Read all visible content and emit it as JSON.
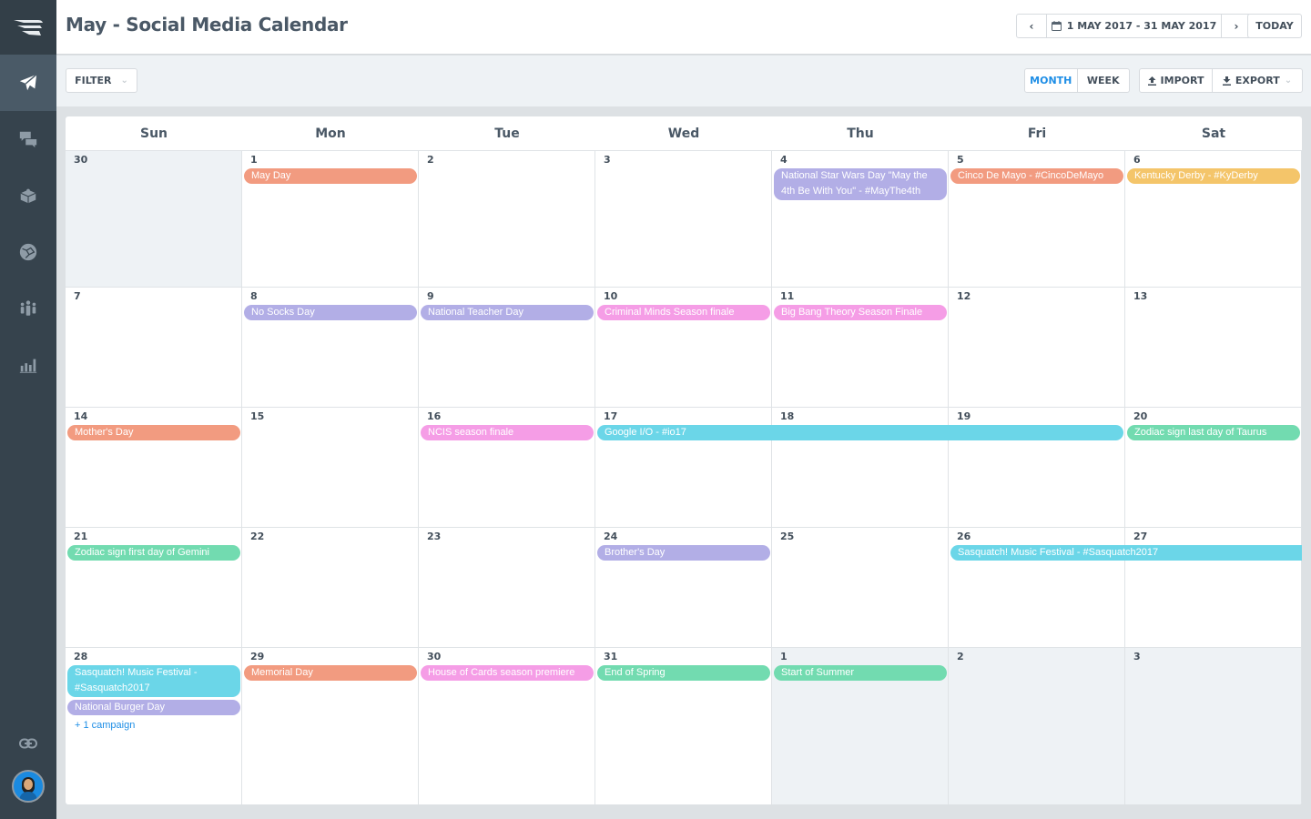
{
  "app": {
    "title": "May - Social Media Calendar"
  },
  "colors": {
    "orange": "#f29b80",
    "purple": "#b2aee6",
    "pink": "#f59de6",
    "cyan": "#6bd6e8",
    "green": "#72dbb0",
    "yellow": "#f4c56a",
    "accent": "#1e8ee6"
  },
  "sidebar": {
    "logo_icon": "wing-logo-icon",
    "items": [
      {
        "name": "publish",
        "icon": "paper-plane-icon",
        "active": true
      },
      {
        "name": "conversations",
        "icon": "chat-bubbles-icon",
        "active": false
      },
      {
        "name": "library",
        "icon": "box-icon",
        "active": false
      },
      {
        "name": "network",
        "icon": "globe-icon",
        "active": false
      },
      {
        "name": "team",
        "icon": "people-icon",
        "active": false
      },
      {
        "name": "reports",
        "icon": "bar-chart-icon",
        "active": false
      }
    ],
    "bottom": [
      {
        "name": "links",
        "icon": "link-icon"
      },
      {
        "name": "profile",
        "icon": "avatar-icon"
      }
    ]
  },
  "header": {
    "date_range": "1 MAY 2017 - 31 MAY 2017",
    "prev_label": "‹",
    "next_label": "›",
    "today_label": "TODAY"
  },
  "toolbar": {
    "filter_label": "FILTER",
    "month_label": "MONTH",
    "week_label": "WEEK",
    "active_view": "MONTH",
    "import_label": "IMPORT",
    "export_label": "EXPORT"
  },
  "calendar": {
    "weekdays": [
      "Sun",
      "Mon",
      "Tue",
      "Wed",
      "Thu",
      "Fri",
      "Sat"
    ],
    "weeks": [
      {
        "days": [
          {
            "n": "30",
            "other": true
          },
          {
            "n": "1"
          },
          {
            "n": "2"
          },
          {
            "n": "3"
          },
          {
            "n": "4"
          },
          {
            "n": "5"
          },
          {
            "n": "6"
          }
        ],
        "events": [
          {
            "label": "May Day",
            "color": "orange",
            "start": 1,
            "span": 1,
            "row": 0
          },
          {
            "label": "National Star Wars Day \"May the 4th Be With You\" - #MayThe4th",
            "color": "purple",
            "start": 4,
            "span": 1,
            "row": 0,
            "tall": true
          },
          {
            "label": "Cinco De Mayo - #CincoDeMayo",
            "color": "orange",
            "start": 5,
            "span": 1,
            "row": 0
          },
          {
            "label": "Kentucky Derby - #KyDerby",
            "color": "yellow",
            "start": 6,
            "span": 1,
            "row": 0
          }
        ]
      },
      {
        "days": [
          {
            "n": "7"
          },
          {
            "n": "8"
          },
          {
            "n": "9"
          },
          {
            "n": "10"
          },
          {
            "n": "11"
          },
          {
            "n": "12"
          },
          {
            "n": "13"
          }
        ],
        "events": [
          {
            "label": "No Socks Day",
            "color": "purple",
            "start": 1,
            "span": 1,
            "row": 0
          },
          {
            "label": "National Teacher Day",
            "color": "purple",
            "start": 2,
            "span": 1,
            "row": 0
          },
          {
            "label": "Criminal Minds Season finale",
            "color": "pink",
            "start": 3,
            "span": 1,
            "row": 0
          },
          {
            "label": "Big Bang Theory Season Finale",
            "color": "pink",
            "start": 4,
            "span": 1,
            "row": 0
          }
        ]
      },
      {
        "days": [
          {
            "n": "14"
          },
          {
            "n": "15"
          },
          {
            "n": "16"
          },
          {
            "n": "17"
          },
          {
            "n": "18"
          },
          {
            "n": "19"
          },
          {
            "n": "20"
          }
        ],
        "events": [
          {
            "label": "Mother's Day",
            "color": "orange",
            "start": 0,
            "span": 1,
            "row": 0
          },
          {
            "label": "NCIS season finale",
            "color": "pink",
            "start": 2,
            "span": 1,
            "row": 0
          },
          {
            "label": "Google I/O - #io17",
            "color": "cyan",
            "start": 3,
            "span": 3,
            "row": 0
          },
          {
            "label": "Zodiac sign last day of Taurus",
            "color": "green",
            "start": 6,
            "span": 1,
            "row": 0
          }
        ]
      },
      {
        "days": [
          {
            "n": "21"
          },
          {
            "n": "22"
          },
          {
            "n": "23"
          },
          {
            "n": "24"
          },
          {
            "n": "25"
          },
          {
            "n": "26"
          },
          {
            "n": "27"
          }
        ],
        "events": [
          {
            "label": "Zodiac sign first day of Gemini",
            "color": "green",
            "start": 0,
            "span": 1,
            "row": 0
          },
          {
            "label": "Brother's Day",
            "color": "purple",
            "start": 3,
            "span": 1,
            "row": 0
          },
          {
            "label": "Sasquatch! Music Festival - #Sasquatch2017",
            "color": "cyan",
            "start": 5,
            "span": 2,
            "row": 0,
            "continues": true
          }
        ]
      },
      {
        "days": [
          {
            "n": "28"
          },
          {
            "n": "29"
          },
          {
            "n": "30"
          },
          {
            "n": "31"
          },
          {
            "n": "1",
            "other": true
          },
          {
            "n": "2",
            "other": true
          },
          {
            "n": "3",
            "other": true
          }
        ],
        "events": [
          {
            "label": "Sasquatch! Music Festival - #Sasquatch2017",
            "color": "cyan",
            "start": 0,
            "span": 1,
            "row": 0,
            "tall": true
          },
          {
            "label": "National Burger Day",
            "color": "purple",
            "start": 0,
            "span": 1,
            "row": 2
          },
          {
            "label": "Memorial Day",
            "color": "orange",
            "start": 1,
            "span": 1,
            "row": 0
          },
          {
            "label": "House of Cards season premiere",
            "color": "pink",
            "start": 2,
            "span": 1,
            "row": 0
          },
          {
            "label": "End of Spring",
            "color": "green",
            "start": 3,
            "span": 1,
            "row": 0
          },
          {
            "label": "Start of Summer",
            "color": "green",
            "start": 4,
            "span": 1,
            "row": 0
          }
        ],
        "more": {
          "label": "+ 1 campaign",
          "day": 0
        }
      }
    ]
  }
}
